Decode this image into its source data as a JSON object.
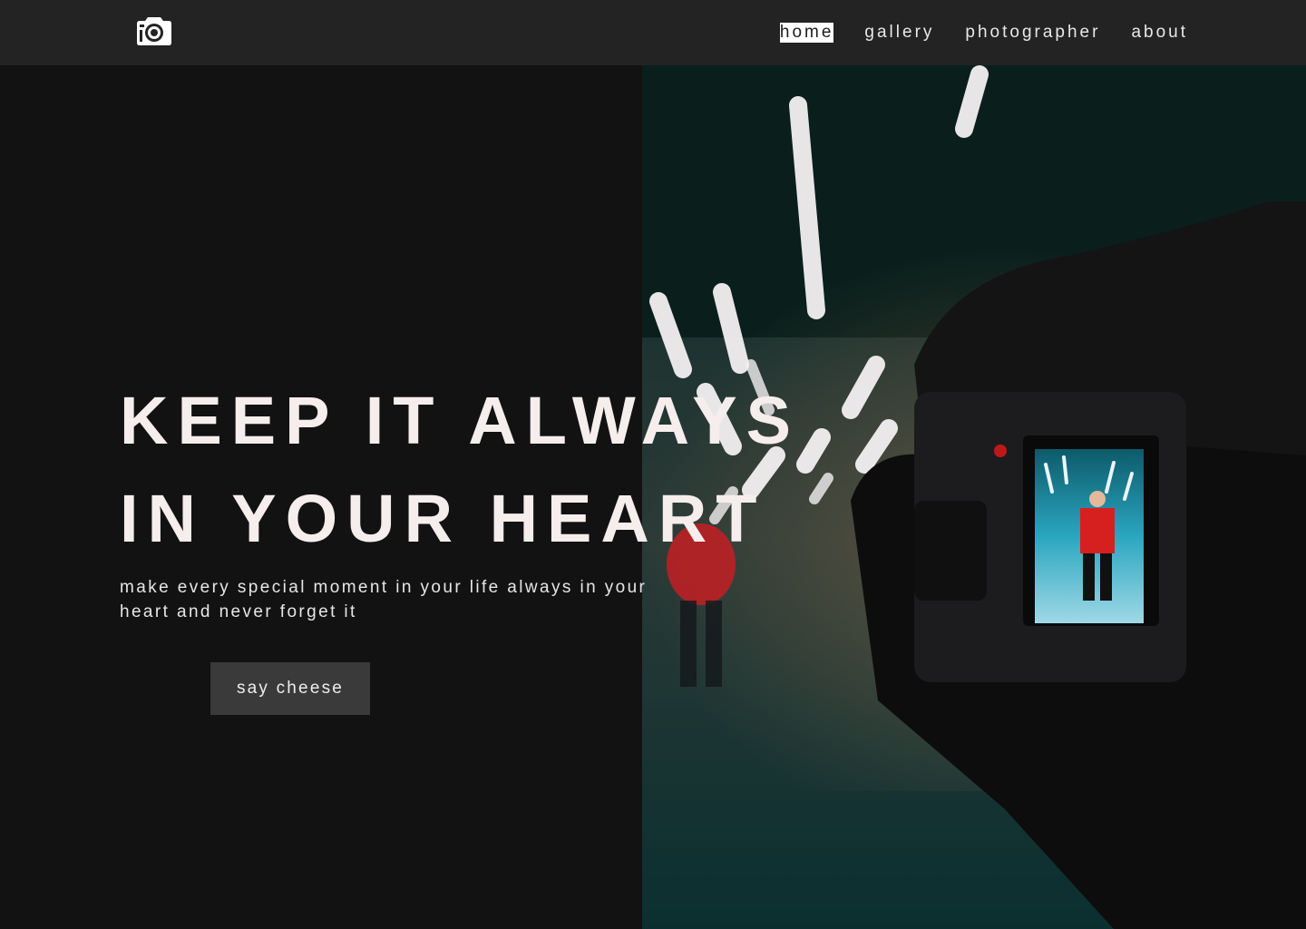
{
  "nav": {
    "logo_icon": "camera-icon",
    "links": [
      {
        "label": "home",
        "active": true
      },
      {
        "label": "gallery"
      },
      {
        "label": "photographer"
      },
      {
        "label": "about"
      }
    ]
  },
  "hero": {
    "title_line1": "KEEP IT ALWAYS",
    "title_line2": "IN YOUR HEART",
    "subtitle": "make every special moment in your life always in your heart and never forget it",
    "cta_label": "say cheese"
  },
  "colors": {
    "navbar_bg": "#232324",
    "page_bg": "#121213",
    "title": "#f6eded",
    "button_bg": "#3a3a3b"
  }
}
